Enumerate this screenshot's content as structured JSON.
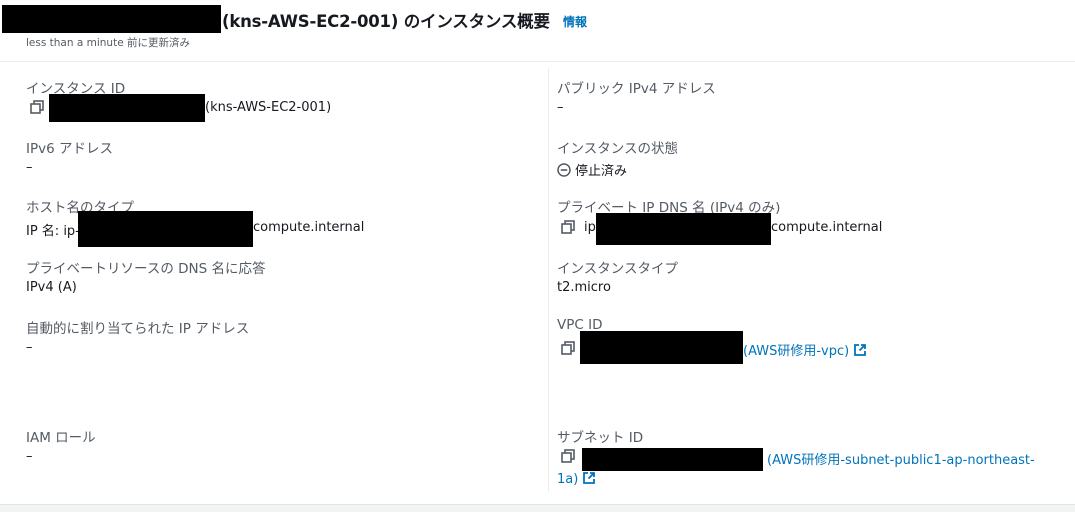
{
  "header": {
    "title": "(kns-AWS-EC2-001) のインスタンス概要",
    "info_link": "情報",
    "updated": "less than a minute 前に更新済み"
  },
  "left": {
    "instance_id": {
      "label": "インスタンス ID",
      "value_suffix": "(kns-AWS-EC2-001)",
      "icon": "copy-icon"
    },
    "ipv6": {
      "label": "IPv6 アドレス",
      "value": "–"
    },
    "hostname_type": {
      "label": "ホスト名のタイプ",
      "value_prefix": "IP 名: ip-",
      "value_suffix": "compute.internal"
    },
    "private_dns_answer": {
      "label": "プライベートリソースの DNS 名に応答",
      "value": "IPv4 (A)"
    },
    "auto_ip": {
      "label": "自動的に割り当てられた IP アドレス",
      "value": "–"
    },
    "iam_role": {
      "label": "IAM ロール",
      "value": "–"
    }
  },
  "right": {
    "public_ipv4": {
      "label": "パブリック IPv4 アドレス",
      "value": "–"
    },
    "instance_state": {
      "label": "インスタンスの状態",
      "value": "停止済み",
      "icon": "stopped-icon"
    },
    "private_ip_dns": {
      "label": "プライベート IP DNS 名 (IPv4 のみ)",
      "value_prefix": "ip",
      "value_suffix": "compute.internal",
      "icon": "copy-icon"
    },
    "instance_type": {
      "label": "インスタンスタイプ",
      "value": "t2.micro"
    },
    "vpc_id": {
      "label": "VPC ID",
      "value_link": "(AWS研修用-vpc)",
      "icon": "external-link-icon"
    },
    "subnet_id": {
      "label": "サブネット ID",
      "value_link_line1": "(AWS研修用-subnet-public1-ap-northeast-",
      "value_link_line2": "1a)",
      "icon": "external-link-icon"
    }
  },
  "colors": {
    "link": "#0073bb",
    "label": "#545b64",
    "text": "#16191f"
  }
}
